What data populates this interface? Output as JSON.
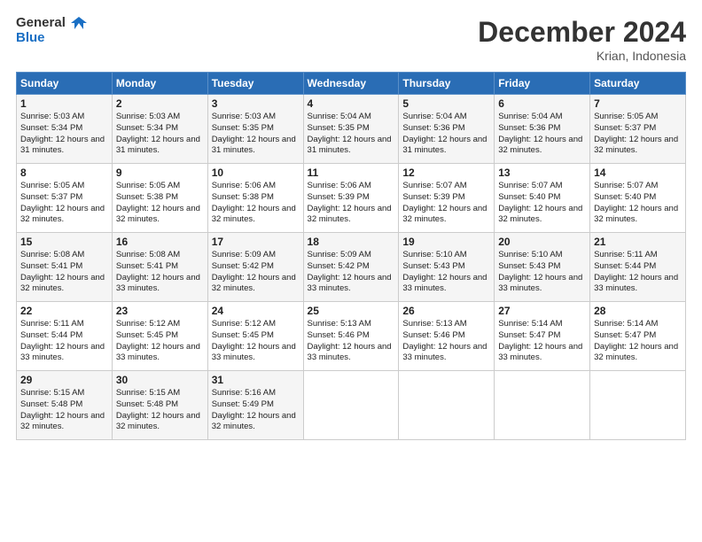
{
  "logo": {
    "line1": "General",
    "line2": "Blue"
  },
  "title": "December 2024",
  "location": "Krian, Indonesia",
  "days_header": [
    "Sunday",
    "Monday",
    "Tuesday",
    "Wednesday",
    "Thursday",
    "Friday",
    "Saturday"
  ],
  "weeks": [
    [
      {
        "day": "1",
        "sr": "5:03 AM",
        "ss": "5:34 PM",
        "dl": "12 hours and 31 minutes."
      },
      {
        "day": "2",
        "sr": "5:03 AM",
        "ss": "5:34 PM",
        "dl": "12 hours and 31 minutes."
      },
      {
        "day": "3",
        "sr": "5:03 AM",
        "ss": "5:35 PM",
        "dl": "12 hours and 31 minutes."
      },
      {
        "day": "4",
        "sr": "5:04 AM",
        "ss": "5:35 PM",
        "dl": "12 hours and 31 minutes."
      },
      {
        "day": "5",
        "sr": "5:04 AM",
        "ss": "5:36 PM",
        "dl": "12 hours and 31 minutes."
      },
      {
        "day": "6",
        "sr": "5:04 AM",
        "ss": "5:36 PM",
        "dl": "12 hours and 32 minutes."
      },
      {
        "day": "7",
        "sr": "5:05 AM",
        "ss": "5:37 PM",
        "dl": "12 hours and 32 minutes."
      }
    ],
    [
      {
        "day": "8",
        "sr": "5:05 AM",
        "ss": "5:37 PM",
        "dl": "12 hours and 32 minutes."
      },
      {
        "day": "9",
        "sr": "5:05 AM",
        "ss": "5:38 PM",
        "dl": "12 hours and 32 minutes."
      },
      {
        "day": "10",
        "sr": "5:06 AM",
        "ss": "5:38 PM",
        "dl": "12 hours and 32 minutes."
      },
      {
        "day": "11",
        "sr": "5:06 AM",
        "ss": "5:39 PM",
        "dl": "12 hours and 32 minutes."
      },
      {
        "day": "12",
        "sr": "5:07 AM",
        "ss": "5:39 PM",
        "dl": "12 hours and 32 minutes."
      },
      {
        "day": "13",
        "sr": "5:07 AM",
        "ss": "5:40 PM",
        "dl": "12 hours and 32 minutes."
      },
      {
        "day": "14",
        "sr": "5:07 AM",
        "ss": "5:40 PM",
        "dl": "12 hours and 32 minutes."
      }
    ],
    [
      {
        "day": "15",
        "sr": "5:08 AM",
        "ss": "5:41 PM",
        "dl": "12 hours and 32 minutes."
      },
      {
        "day": "16",
        "sr": "5:08 AM",
        "ss": "5:41 PM",
        "dl": "12 hours and 33 minutes."
      },
      {
        "day": "17",
        "sr": "5:09 AM",
        "ss": "5:42 PM",
        "dl": "12 hours and 32 minutes."
      },
      {
        "day": "18",
        "sr": "5:09 AM",
        "ss": "5:42 PM",
        "dl": "12 hours and 33 minutes."
      },
      {
        "day": "19",
        "sr": "5:10 AM",
        "ss": "5:43 PM",
        "dl": "12 hours and 33 minutes."
      },
      {
        "day": "20",
        "sr": "5:10 AM",
        "ss": "5:43 PM",
        "dl": "12 hours and 33 minutes."
      },
      {
        "day": "21",
        "sr": "5:11 AM",
        "ss": "5:44 PM",
        "dl": "12 hours and 33 minutes."
      }
    ],
    [
      {
        "day": "22",
        "sr": "5:11 AM",
        "ss": "5:44 PM",
        "dl": "12 hours and 33 minutes."
      },
      {
        "day": "23",
        "sr": "5:12 AM",
        "ss": "5:45 PM",
        "dl": "12 hours and 33 minutes."
      },
      {
        "day": "24",
        "sr": "5:12 AM",
        "ss": "5:45 PM",
        "dl": "12 hours and 33 minutes."
      },
      {
        "day": "25",
        "sr": "5:13 AM",
        "ss": "5:46 PM",
        "dl": "12 hours and 33 minutes."
      },
      {
        "day": "26",
        "sr": "5:13 AM",
        "ss": "5:46 PM",
        "dl": "12 hours and 33 minutes."
      },
      {
        "day": "27",
        "sr": "5:14 AM",
        "ss": "5:47 PM",
        "dl": "12 hours and 33 minutes."
      },
      {
        "day": "28",
        "sr": "5:14 AM",
        "ss": "5:47 PM",
        "dl": "12 hours and 32 minutes."
      }
    ],
    [
      {
        "day": "29",
        "sr": "5:15 AM",
        "ss": "5:48 PM",
        "dl": "12 hours and 32 minutes."
      },
      {
        "day": "30",
        "sr": "5:15 AM",
        "ss": "5:48 PM",
        "dl": "12 hours and 32 minutes."
      },
      {
        "day": "31",
        "sr": "5:16 AM",
        "ss": "5:49 PM",
        "dl": "12 hours and 32 minutes."
      },
      null,
      null,
      null,
      null
    ]
  ]
}
